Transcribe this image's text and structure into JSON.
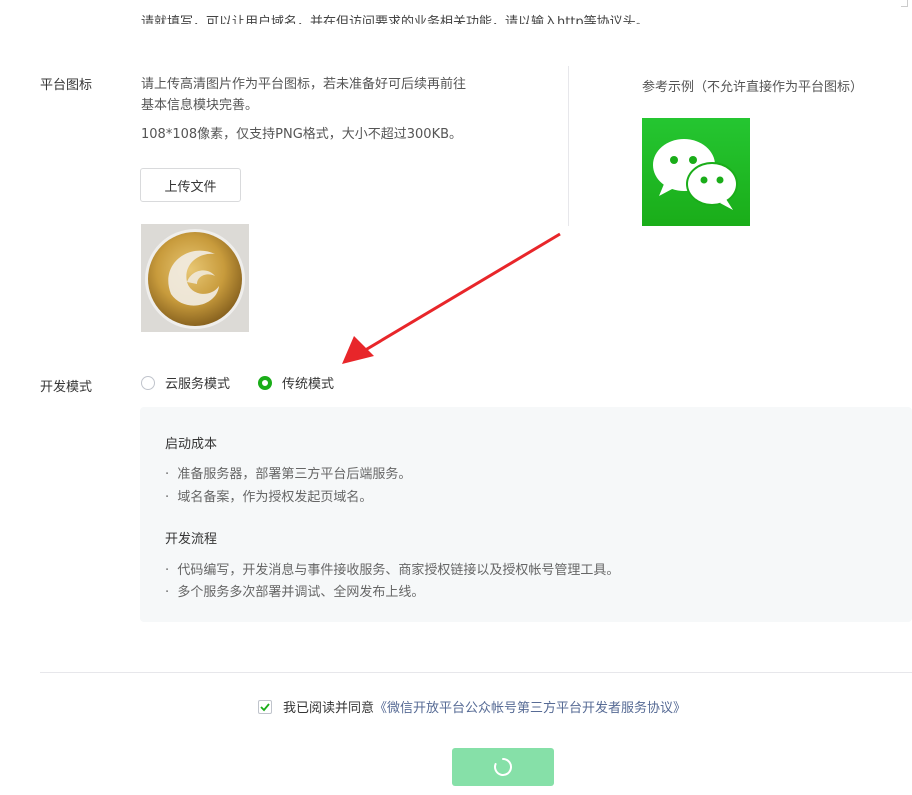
{
  "top": {
    "cut_text": "请就填写，可以让用户域名，并在但访问要求的业务相关功能，请以输入http等协议头。"
  },
  "platform_icon": {
    "label": "平台图标",
    "desc_line1": "请上传高清图片作为平台图标，若未准备好可后续再前往",
    "desc_line2": "基本信息模块完善。",
    "spec": "108*108像素，仅支持PNG格式，大小不超过300KB。",
    "upload_label": "上传文件",
    "reference_label": "参考示例（不允许直接作为平台图标）"
  },
  "dev_mode": {
    "label": "开发模式",
    "options": [
      {
        "label": "云服务模式",
        "checked": false
      },
      {
        "label": "传统模式",
        "checked": true
      }
    ],
    "info": {
      "cost_title": "启动成本",
      "cost_items": [
        "准备服务器，部署第三方平台后端服务。",
        "域名备案，作为授权发起页域名。"
      ],
      "flow_title": "开发流程",
      "flow_items": [
        "代码编写，开发消息与事件接收服务、商家授权链接以及授权帐号管理工具。",
        "多个服务多次部署并调试、全网发布上线。"
      ]
    }
  },
  "agreement": {
    "checked": true,
    "text": "我已阅读并同意",
    "link": "《微信开放平台公众帐号第三方平台开发者服务协议》"
  },
  "colors": {
    "accent": "#1aad19",
    "link": "#576b95",
    "arrow": "#e8262a",
    "button_disabled": "#86e0a8"
  },
  "icons": [
    "wechat-logo-icon",
    "red-arrow-annotation",
    "loading-spinner-icon",
    "checkmark-icon"
  ]
}
